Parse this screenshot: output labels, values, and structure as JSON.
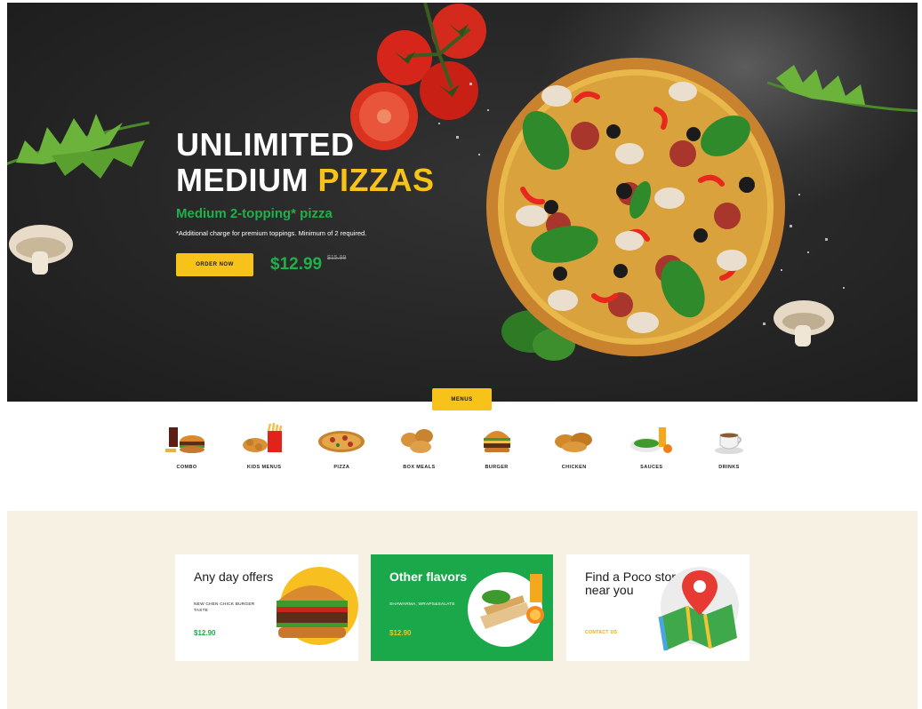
{
  "hero": {
    "title_line1": "UNLIMITED",
    "title_line2_white": "MEDIUM",
    "title_line2_accent": "PIZZAS",
    "subtitle": "Medium 2-topping* pizza",
    "note": "*Additional charge for premium toppings. Minimum of 2 required.",
    "order_button": "ORDER NOW",
    "price": "$12.99",
    "old_price": "$15.99"
  },
  "menu_tab": "MENUS",
  "categories": [
    {
      "label": "COMBO",
      "icon": "combo-icon"
    },
    {
      "label": "KIDS MENUS",
      "icon": "kids-menu-icon"
    },
    {
      "label": "PIZZA",
      "icon": "pizza-icon"
    },
    {
      "label": "BOX MEALS",
      "icon": "box-meals-icon"
    },
    {
      "label": "BURGER",
      "icon": "burger-icon"
    },
    {
      "label": "CHICKEN",
      "icon": "chicken-icon"
    },
    {
      "label": "SAUCES",
      "icon": "sauces-icon"
    },
    {
      "label": "DRINKS",
      "icon": "drinks-icon"
    }
  ],
  "cards": [
    {
      "title": "Any day offers",
      "desc": "NEW CHEN CHICK BURGER TASTE",
      "price": "$12.90"
    },
    {
      "title": "Other flavors",
      "desc": "SHAWARMA, WRAPS&SALATE",
      "price": "$12.90"
    },
    {
      "title": "Find a Poco store near you",
      "link": "CONTACT US"
    }
  ],
  "colors": {
    "accent_yellow": "#f7c21a",
    "brand_green": "#1eb14a",
    "hero_bg": "#262626",
    "promo_bg": "#f7f1e4"
  }
}
